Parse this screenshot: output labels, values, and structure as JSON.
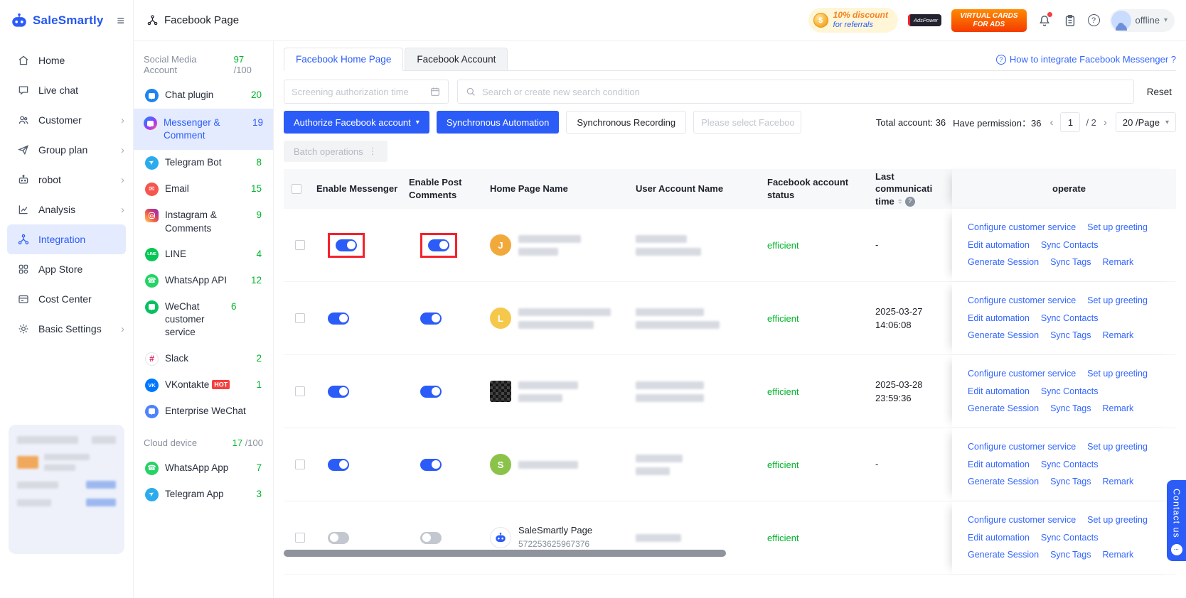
{
  "brand": {
    "name": "SaleSmartly",
    "accent": "#2B5CF8"
  },
  "colors": {
    "accent": "#2B5CF8",
    "success_green": "#00B42A",
    "highlight_red": "#F5222D",
    "hot_badge_red": "#F53F3F"
  },
  "icons": {
    "logo": "robot-icon",
    "collapse": "hamburger-icon",
    "page_title": "hierarchy-icon",
    "notifications": "bell-icon",
    "tasks": "clipboard-icon",
    "help": "question-circle-icon",
    "search": "magnifier-icon",
    "date": "calendar-icon",
    "sort": "sort-carets-icon",
    "batch_more": "vertical-dots-icon",
    "dropdown": "caret-down-icon"
  },
  "left_nav": {
    "items": [
      {
        "label": "Home",
        "icon": "home-icon",
        "chevron": false,
        "active": false
      },
      {
        "label": "Live chat",
        "icon": "live-chat-icon",
        "chevron": false,
        "active": false
      },
      {
        "label": "Customer",
        "icon": "customer-icon",
        "chevron": true,
        "active": false
      },
      {
        "label": "Group plan",
        "icon": "group-plan-icon",
        "chevron": true,
        "active": false
      },
      {
        "label": "robot",
        "icon": "robot-icon",
        "chevron": true,
        "active": false
      },
      {
        "label": "Analysis",
        "icon": "analysis-icon",
        "chevron": true,
        "active": false
      },
      {
        "label": "Integration",
        "icon": "integration-icon",
        "chevron": false,
        "active": true
      },
      {
        "label": "App Store",
        "icon": "app-store-icon",
        "chevron": false,
        "active": false
      },
      {
        "label": "Cost Center",
        "icon": "cost-center-icon",
        "chevron": false,
        "active": false
      },
      {
        "label": "Basic Settings",
        "icon": "settings-icon",
        "chevron": true,
        "active": false
      }
    ]
  },
  "topbar": {
    "title": "Facebook Page",
    "referral_badge_line1": "10% discount",
    "referral_badge_line2": "for referrals",
    "adspower_label": "AdsPower",
    "virtual_cards_line1": "VIRTUAL CARDS",
    "virtual_cards_line2": "FOR ADS",
    "status_label": "offline"
  },
  "channel_panel": {
    "social_title": "Social Media Account",
    "social_count": "97",
    "social_max": " /100",
    "items": [
      {
        "label": "Chat plugin",
        "count": "20",
        "active": false
      },
      {
        "label": "Messenger & Comment",
        "count": "19",
        "active": true
      },
      {
        "label": "Telegram Bot",
        "count": "8",
        "active": false
      },
      {
        "label": "Email",
        "count": "15",
        "active": false
      },
      {
        "label": "Instagram & Comments",
        "count": "9",
        "active": false
      },
      {
        "label": "LINE",
        "count": "4",
        "active": false
      },
      {
        "label": "WhatsApp API",
        "count": "12",
        "active": false
      },
      {
        "label": "WeChat customer service",
        "count": "6",
        "active": false
      },
      {
        "label": "Slack",
        "count": "2",
        "active": false
      },
      {
        "label": "VKontakte",
        "count": "1",
        "active": false,
        "hot": "HOT"
      },
      {
        "label": "Enterprise WeChat",
        "count": "",
        "active": false
      }
    ],
    "cloud_title": "Cloud device",
    "cloud_count": "17",
    "cloud_max": " /100",
    "cloud_items": [
      {
        "label": "WhatsApp App",
        "count": "7"
      },
      {
        "label": "Telegram App",
        "count": "3"
      }
    ]
  },
  "main": {
    "tabs": [
      {
        "label": "Facebook Home Page",
        "active": true
      },
      {
        "label": "Facebook Account",
        "active": false
      }
    ],
    "help_link": "How to integrate Facebook Messenger ?",
    "filters": {
      "date_placeholder": "Screening authorization time",
      "search_placeholder": "Search or create new search condition",
      "reset_label": "Reset"
    },
    "toolbar": {
      "authorize_label": "Authorize Facebook account",
      "sync_automation_label": "Synchronous Automation",
      "sync_recording_label": "Synchronous Recording",
      "select_placeholder": "Please select Faceboo",
      "total_label": "Total account: 36",
      "permission_label": "Have permission：36",
      "page_current": "1",
      "page_total": "/ 2",
      "page_size": "20 /Page",
      "batch_label": "Batch operations"
    },
    "table": {
      "headers": {
        "enable_messenger": "Enable Messenger",
        "enable_post": "Enable Post Comments",
        "home_page": "Home Page Name",
        "user_account": "User Account Name",
        "fb_status": "Facebook account status",
        "last_line1": "Last communicati",
        "last_line2": "time",
        "operate": "operate"
      },
      "operate_links": [
        "Configure customer service",
        "Set up greeting",
        "Edit automation",
        "Sync Contacts",
        "Generate Session",
        "Sync Tags",
        "Remark"
      ],
      "rows": [
        {
          "messenger_state": "on",
          "post_state": "on",
          "highlighted": true,
          "avatar_text": "J",
          "status": "efficient",
          "last_time": "-"
        },
        {
          "messenger_state": "on",
          "post_state": "on",
          "highlighted": false,
          "avatar_text": "L",
          "status": "efficient",
          "last_time": "2025-03-27 14:06:08"
        },
        {
          "messenger_state": "on",
          "post_state": "on",
          "highlighted": false,
          "avatar_text": "",
          "status": "efficient",
          "last_time": "2025-03-28 23:59:36"
        },
        {
          "messenger_state": "on",
          "post_state": "on",
          "highlighted": false,
          "avatar_text": "S",
          "status": "efficient",
          "last_time": "-"
        },
        {
          "messenger_state": "off",
          "post_state": "off",
          "highlighted": false,
          "avatar_text": "",
          "page_name": "SaleSmartly Page",
          "page_id": "572253625967376",
          "status": "efficient",
          "last_time": ""
        }
      ]
    }
  },
  "contact": {
    "label": "Contact us"
  }
}
